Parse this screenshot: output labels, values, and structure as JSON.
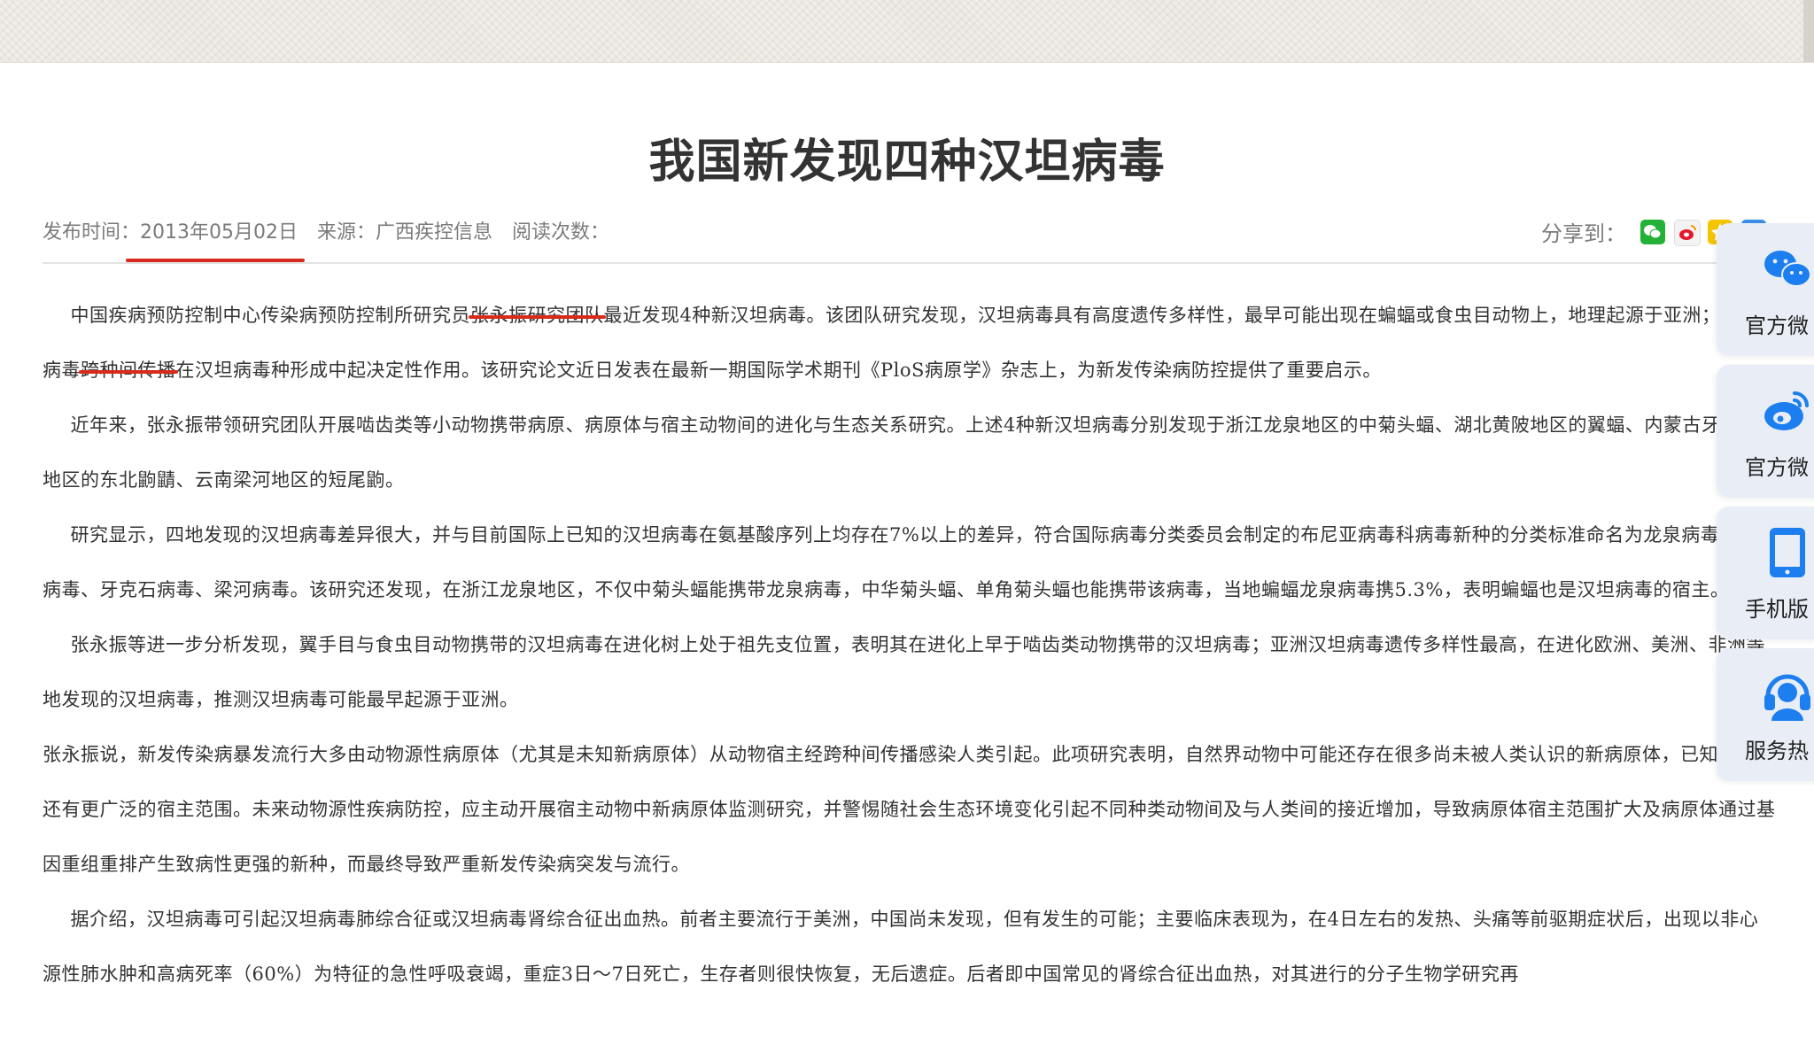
{
  "article": {
    "title": "我国新发现四种汉坦病毒",
    "meta": {
      "publish_label": "发布时间：",
      "publish_date": "2013年05月02日",
      "source_label": "来源：",
      "source_value": "广西疾控信息",
      "reads_label": "阅读次数："
    },
    "share_label": "分享到：",
    "paragraphs": [
      {
        "pre": "中国疾病预防控制中心传染病预防控制所研究员",
        "hl1": "张永振研究团队",
        "mid": "最近发现4种新汉坦病毒。该团队研究发现，汉坦病毒具有高度遗传多样性，最早可能出现在蝙蝠或食虫目动物上，地理起源于亚洲；汉坦病毒",
        "hl2": "跨种间传播",
        "post": "在汉坦病毒种形成中起决定性作用。该研究论文近日发表在最新一期国际学术期刊《PloS病原学》杂志上，为新发传染病防控提供了重要启示。"
      },
      {
        "text": "近年来，张永振带领研究团队开展啮齿类等小动物携带病原、病原体与宿主动物间的进化与生态关系研究。上述4种新汉坦病毒分别发现于浙江龙泉地区的中菊头蝠、湖北黄陂地区的翼蝠、内蒙古牙克石地区的东北鼩鼱、云南梁河地区的短尾鼩。"
      },
      {
        "text": "研究显示，四地发现的汉坦病毒差异很大，并与目前国际上已知的汉坦病毒在氨基酸序列上均存在7%以上的差异，符合国际病毒分类委员会制定的布尼亚病毒科病毒新种的分类标准命名为龙泉病毒、黄陂病毒、牙克石病毒、梁河病毒。该研究还发现，在浙江龙泉地区，不仅中菊头蝠能携带龙泉病毒，中华菊头蝠、单角菊头蝠也能携带该病毒，当地蝙蝠龙泉病毒携5.3%，表明蝙蝠也是汉坦病毒的宿主。"
      },
      {
        "text": "张永振等进一步分析发现，翼手目与食虫目动物携带的汉坦病毒在进化树上处于祖先支位置，表明其在进化上早于啮齿类动物携带的汉坦病毒；亚洲汉坦病毒遗传多样性最高，在进化欧洲、美洲、非洲等地发现的汉坦病毒，推测汉坦病毒可能最早起源于亚洲。"
      },
      {
        "text": "张永振说，新发传染病暴发流行大多由动物源性病原体（尤其是未知新病原体）从动物宿主经跨种间传播感染人类引起。此项研究表明，自然界动物中可能还存在很多尚未被人类认识的新病原体，已知病原体还有更广泛的宿主范围。未来动物源性疾病防控，应主动开展宿主动物中新病原体监测研究，并警惕随社会生态环境变化引起不同种类动物间及与人类间的接近增加，导致病原体宿主范围扩大及病原体通过基因重组重排产生致病性更强的新种，而最终导致严重新发传染病突发与流行。"
      },
      {
        "text": "据介绍，汉坦病毒可引起汉坦病毒肺综合征或汉坦病毒肾综合征出血热。前者主要流行于美洲，中国尚未发现，但有发生的可能；主要临床表现为，在4日左右的发热、头痛等前驱期症状后，出现以非心源性肺水肿和高病死率（60%）为特征的急性呼吸衰竭，重症3日～7日死亡，生存者则很快恢复，无后遗症。后者即中国常见的肾综合征出血热，对其进行的分子生物学研究再"
      }
    ]
  },
  "sidebar": {
    "items": [
      {
        "label": "官方微",
        "icon": "wechat-icon"
      },
      {
        "label": "官方微",
        "icon": "weibo-icon"
      },
      {
        "label": "手机版",
        "icon": "mobile-icon"
      },
      {
        "label": "服务热",
        "icon": "headset-icon"
      }
    ]
  },
  "colors": {
    "accent_red": "#d92b1c",
    "sidebar_blue": "#1d7ef0",
    "sidebar_bg": "#e9eef6"
  }
}
